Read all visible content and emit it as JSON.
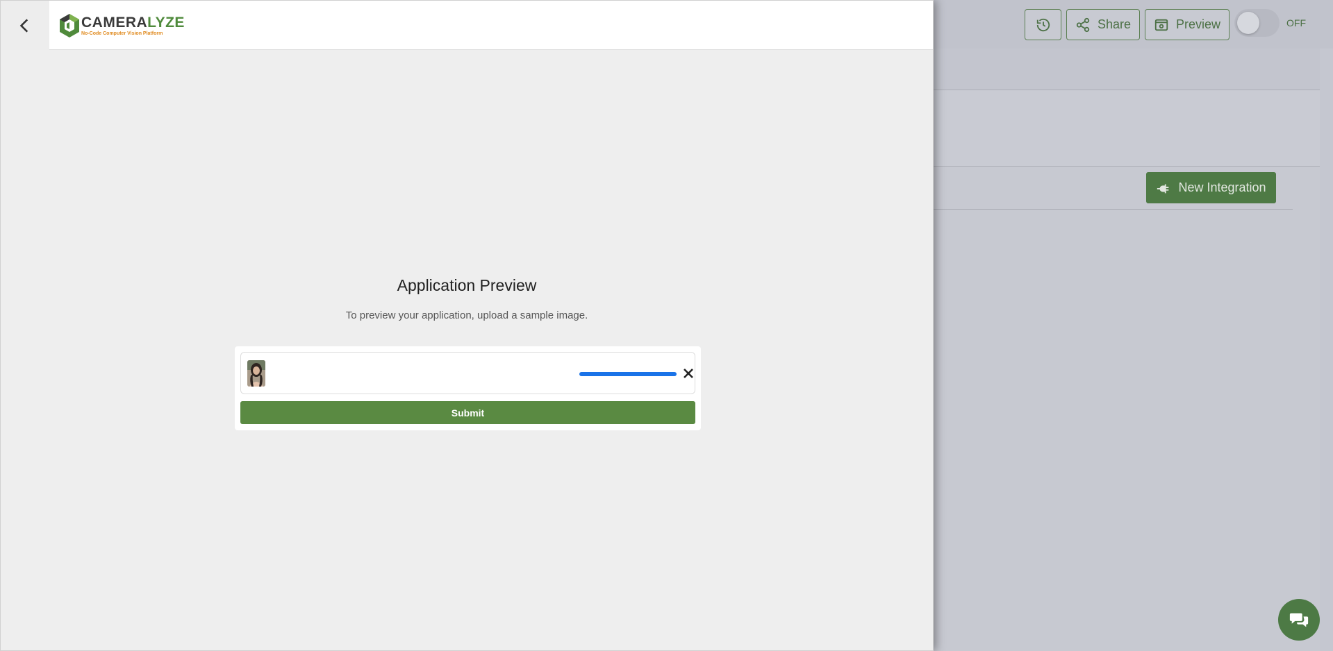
{
  "brand": {
    "name_part1": "CAMERA",
    "name_part2": "LYZE",
    "tagline": "No-Code Computer Vision Platform",
    "primary_color": "#5a8a42"
  },
  "toolbar": {
    "history_icon": "history-icon",
    "share_label": "Share",
    "preview_label": "Preview",
    "toggle_state_label": "OFF"
  },
  "integrations": {
    "new_integration_label": "New Integration"
  },
  "preview": {
    "title": "Application Preview",
    "subtitle": "To preview your application, upload a sample image.",
    "upload_progress": 1.0,
    "submit_label": "Submit"
  },
  "icons": {
    "back": "chevron-left-icon",
    "remove": "close-icon",
    "chat": "chat-bubbles-icon",
    "plug": "plug-icon"
  }
}
